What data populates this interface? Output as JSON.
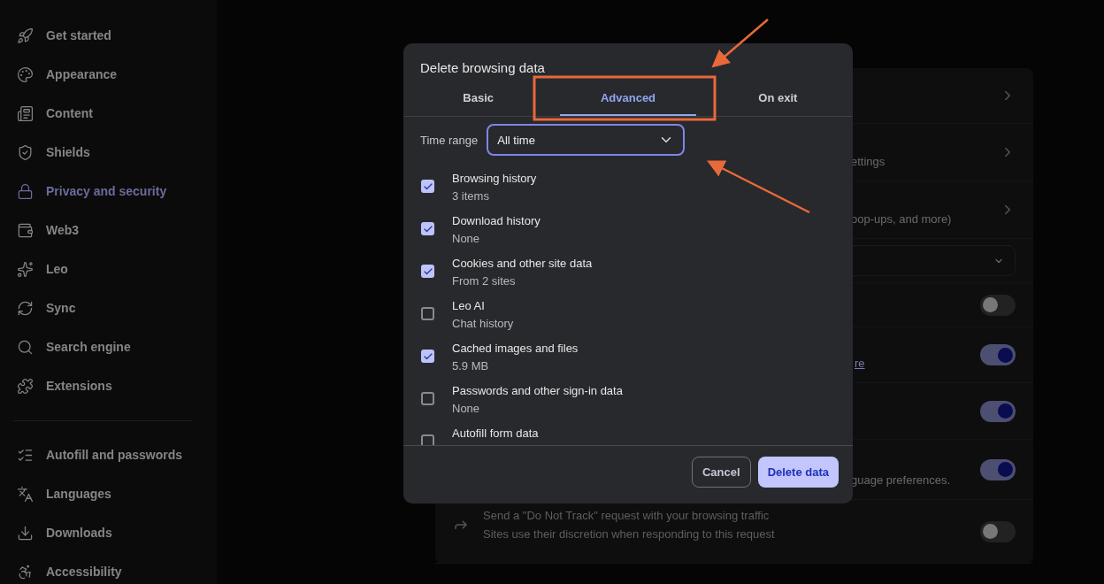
{
  "sidebar": {
    "groups": [
      {
        "items": [
          {
            "label": "Get started",
            "selected": false
          },
          {
            "label": "Appearance",
            "selected": false
          },
          {
            "label": "Content",
            "selected": false
          },
          {
            "label": "Shields",
            "selected": false
          },
          {
            "label": "Privacy and security",
            "selected": true
          },
          {
            "label": "Web3",
            "selected": false
          },
          {
            "label": "Leo",
            "selected": false
          },
          {
            "label": "Sync",
            "selected": false
          },
          {
            "label": "Search engine",
            "selected": false
          },
          {
            "label": "Extensions",
            "selected": false
          }
        ]
      },
      {
        "items": [
          {
            "label": "Autofill and passwords",
            "selected": false
          },
          {
            "label": "Languages",
            "selected": false
          },
          {
            "label": "Downloads",
            "selected": false
          },
          {
            "label": "Accessibility",
            "selected": false
          }
        ]
      }
    ]
  },
  "settings_rows": [
    {
      "kind": "chevron"
    },
    {
      "kind": "chevron",
      "fragment": "ettings"
    },
    {
      "kind": "chevron",
      "fragment": "oop-ups, and more)"
    },
    {
      "kind": "select"
    },
    {
      "kind": "toggle",
      "on": false
    },
    {
      "kind": "toggle",
      "on": true,
      "link": "re"
    },
    {
      "kind": "toggle",
      "on": true
    },
    {
      "kind": "toggle",
      "on": true,
      "fragment": "guage preferences."
    },
    {
      "kind": "toggle",
      "on": false,
      "title": "Send a \"Do Not Track\" request with your browsing traffic",
      "description": "Sites use their discretion when responding to this request"
    }
  ],
  "dialog": {
    "title": "Delete browsing data",
    "tabs": [
      {
        "label": "Basic",
        "selected": false
      },
      {
        "label": "Advanced",
        "selected": true
      },
      {
        "label": "On exit",
        "selected": false
      }
    ],
    "time_range": {
      "label": "Time range",
      "value": "All time"
    },
    "items": [
      {
        "label": "Browsing history",
        "detail": "3 items",
        "checked": true
      },
      {
        "label": "Download history",
        "detail": "None",
        "checked": true
      },
      {
        "label": "Cookies and other site data",
        "detail": "From 2 sites",
        "checked": true
      },
      {
        "label": "Leo AI",
        "detail": "Chat history",
        "checked": false
      },
      {
        "label": "Cached images and files",
        "detail": "5.9 MB",
        "checked": true
      },
      {
        "label": "Passwords and other sign-in data",
        "detail": "None",
        "checked": false
      },
      {
        "label": "Autofill form data",
        "checked": false
      }
    ],
    "buttons": [
      {
        "label": "Cancel",
        "kind": "secondary"
      },
      {
        "label": "Delete data",
        "kind": "primary"
      }
    ]
  }
}
